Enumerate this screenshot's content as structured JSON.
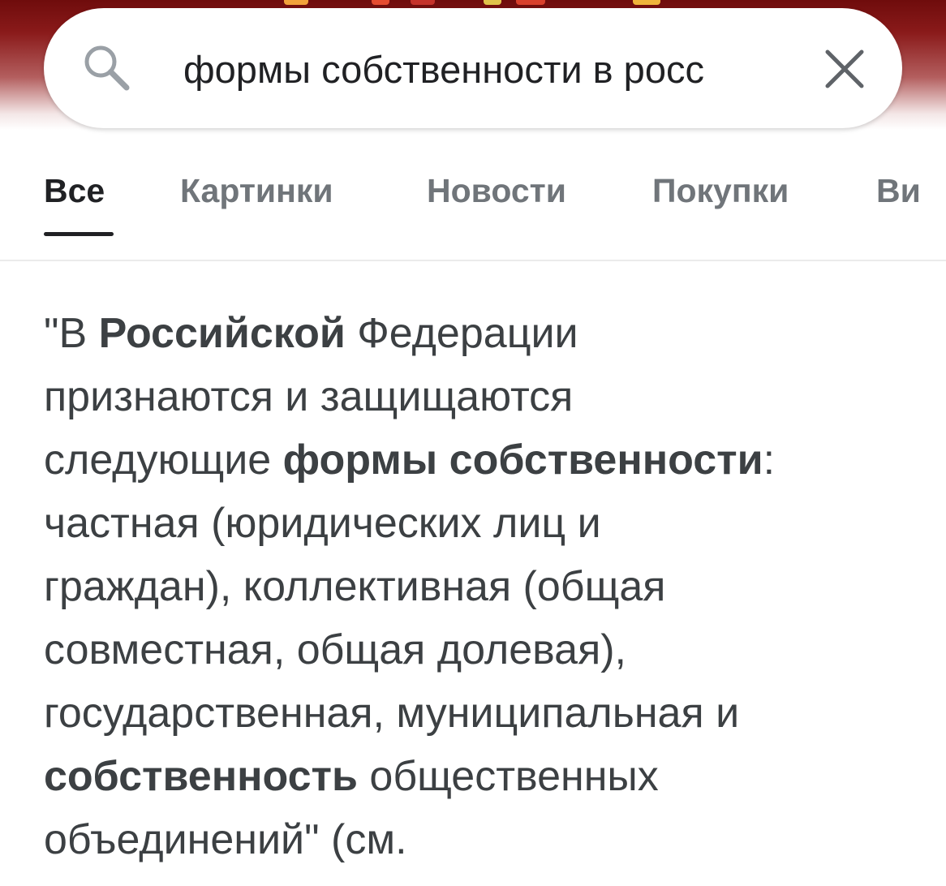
{
  "search": {
    "query": "формы собственности в росс",
    "placeholder": ""
  },
  "tabs": [
    {
      "label": "Все",
      "active": true
    },
    {
      "label": "Картинки",
      "active": false
    },
    {
      "label": "Новости",
      "active": false
    },
    {
      "label": "Покупки",
      "active": false
    },
    {
      "label": "Ви",
      "active": false
    }
  ],
  "snippet": {
    "line1": {
      "a": "\"В ",
      "b": "Российской",
      "c": " Федерации"
    },
    "line2": "признаются и защищаются",
    "line3": {
      "a": "следующие ",
      "b": "формы собственности",
      "c": ":"
    },
    "line4": "частная (юридических лиц и",
    "line5": "граждан), коллективная (общая",
    "line6": "совместная, общая долевая),",
    "line7": "государственная, муниципальная и",
    "line8": {
      "b": "собственность",
      "c": " общественных"
    },
    "line9": "объединений\" (см."
  },
  "colors": {
    "header_band": "#7a1111",
    "text_primary": "#202124",
    "text_secondary": "#70757a",
    "snippet_text": "#3c4043"
  },
  "icons": {
    "search": "search-icon",
    "clear": "close-icon"
  }
}
